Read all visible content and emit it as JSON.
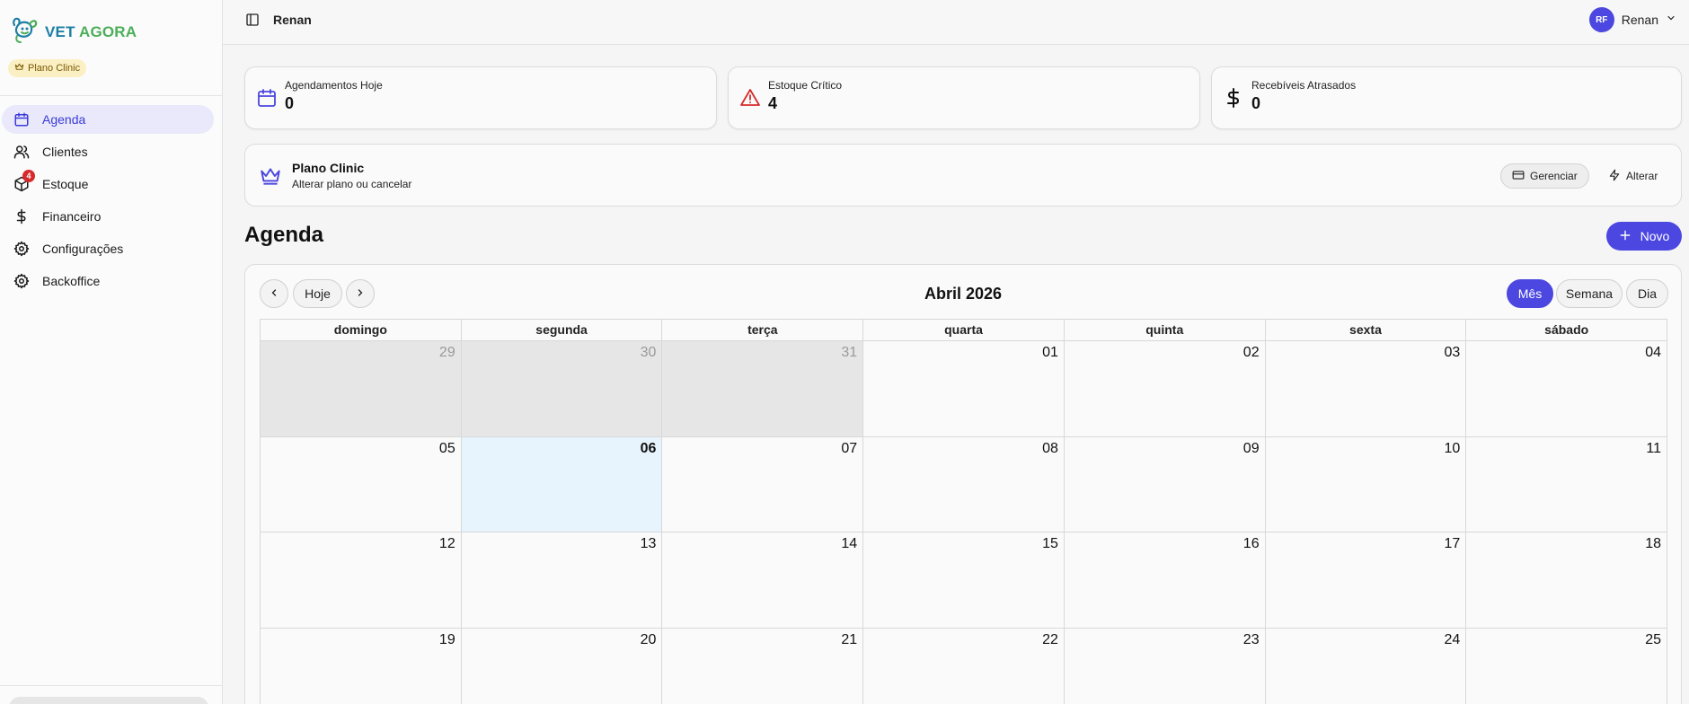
{
  "brand": {
    "part1": "VET",
    "part2": "AGORA"
  },
  "plan_badge": "Plano Clinic",
  "sidebar": {
    "items": [
      {
        "label": "Agenda",
        "icon": "calendar-icon",
        "active": true
      },
      {
        "label": "Clientes",
        "icon": "users-icon"
      },
      {
        "label": "Estoque",
        "icon": "package-icon",
        "badge": "4"
      },
      {
        "label": "Financeiro",
        "icon": "dollar-icon"
      },
      {
        "label": "Configurações",
        "icon": "gear-icon"
      },
      {
        "label": "Backoffice",
        "icon": "gear-icon"
      }
    ]
  },
  "topbar": {
    "title": "Renan",
    "user_initials": "RF",
    "user_name": "Renan"
  },
  "stats": [
    {
      "label": "Agendamentos Hoje",
      "value": "0",
      "icon": "calendar-icon"
    },
    {
      "label": "Estoque Crítico",
      "value": "4",
      "icon": "alert-triangle-icon"
    },
    {
      "label": "Recebíveis Atrasados",
      "value": "0",
      "icon": "dollar-icon"
    }
  ],
  "plan_card": {
    "title": "Plano Clinic",
    "subtitle": "Alterar plano ou cancelar",
    "manage_label": "Gerenciar",
    "alter_label": "Alterar"
  },
  "agenda": {
    "title": "Agenda",
    "new_label": "Novo"
  },
  "calendar": {
    "today_label": "Hoje",
    "title": "Abril 2026",
    "views": [
      {
        "label": "Mês",
        "active": true
      },
      {
        "label": "Semana"
      },
      {
        "label": "Dia"
      }
    ],
    "weekdays": [
      "domingo",
      "segunda",
      "terça",
      "quarta",
      "quinta",
      "sexta",
      "sábado"
    ],
    "weeks": [
      [
        "29",
        "30",
        "31",
        "01",
        "02",
        "03",
        "04"
      ],
      [
        "05",
        "06",
        "07",
        "08",
        "09",
        "10",
        "11"
      ],
      [
        "12",
        "13",
        "14",
        "15",
        "16",
        "17",
        "18"
      ],
      [
        "19",
        "20",
        "21",
        "22",
        "23",
        "24",
        "25"
      ]
    ],
    "today": "06"
  },
  "colors": {
    "accent": "#4b47e0",
    "brand_blue": "#1e7fa6",
    "brand_green": "#4cae5a",
    "danger": "#d62b2b",
    "today_bg": "#e8f4fd"
  }
}
